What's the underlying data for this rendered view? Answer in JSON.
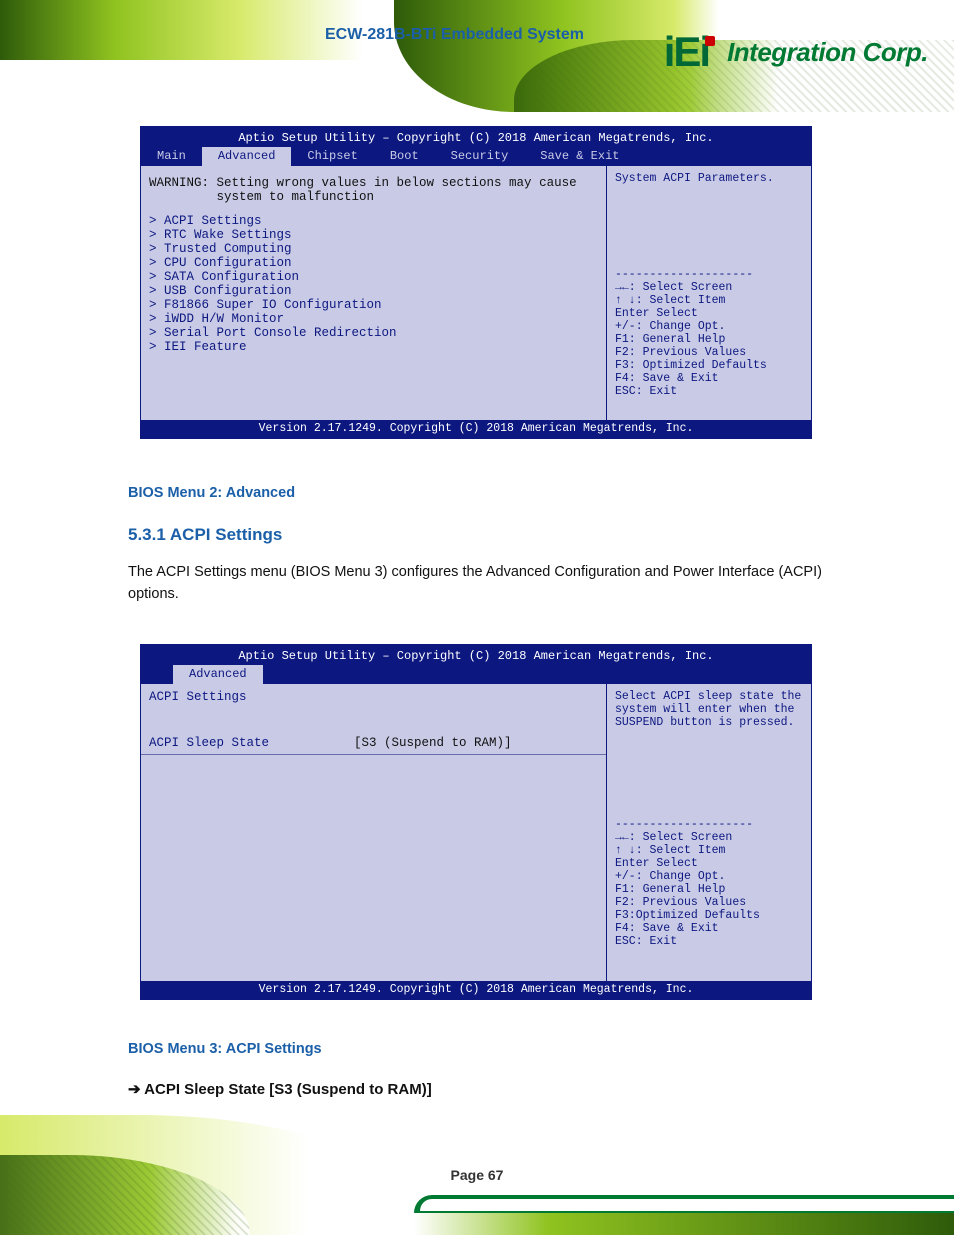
{
  "doc_title": "ECW-281B-BTi Embedded System",
  "logo": {
    "brand": "iEi",
    "suffix": "Integration Corp."
  },
  "bios1": {
    "top": "Aptio Setup Utility – Copyright (C) 2018 American Megatrends, Inc.",
    "tabs": [
      "Main",
      "Advanced",
      "Chipset",
      "Boot",
      "Security",
      "Save & Exit"
    ],
    "warn_line1": "WARNING: Setting wrong values in below sections may cause",
    "warn_line2": "         system to malfunction",
    "items": [
      "> ACPI Settings",
      "> RTC Wake Settings",
      "> Trusted Computing",
      "> CPU Configuration",
      "> SATA Configuration",
      "> USB Configuration",
      "> F81866 Super IO Configuration",
      "> iWDD H/W Monitor",
      "> Serial Port Console Redirection",
      "> IEI Feature"
    ],
    "help_desc": "System ACPI Parameters.",
    "help_lines": [
      "--------------------",
      "→←: Select Screen",
      "↑ ↓: Select Item",
      "Enter Select",
      "+/-: Change Opt.",
      "F1: General Help",
      "F2: Previous Values",
      "F3: Optimized Defaults",
      "F4: Save & Exit",
      "ESC: Exit"
    ],
    "foot": "Version 2.17.1249. Copyright (C) 2018 American Megatrends, Inc."
  },
  "text1": {
    "caption": "BIOS Menu 2: Advanced",
    "section": "5.3.1 ACPI Settings",
    "body": "The ACPI Settings menu (BIOS Menu 3) configures the Advanced Configuration and Power Interface (ACPI) options."
  },
  "bios2": {
    "top": "Aptio Setup Utility – Copyright (C) 2018 American Megatrends, Inc.",
    "tabs": [
      "",
      "Advanced"
    ],
    "subhdr": "ACPI Settings",
    "kv": {
      "label": "ACPI Sleep State",
      "value": "[S3 (Suspend to RAM)]"
    },
    "help_desc": "Select ACPI sleep state the system will enter when the SUSPEND button is pressed.",
    "help_lines": [
      "--------------------",
      "→←: Select Screen",
      "↑ ↓: Select Item",
      "Enter Select",
      "+/-: Change Opt.",
      "F1: General Help",
      "F2: Previous Values",
      "F3:Optimized Defaults",
      "F4: Save & Exit",
      "ESC: Exit"
    ],
    "foot": "Version 2.17.1249. Copyright (C) 2018 American Megatrends, Inc."
  },
  "text2": {
    "caption": "BIOS Menu 3: ACPI Settings",
    "subhd": "➔ ACPI Sleep State [S3 (Suspend to RAM)]"
  },
  "page_number": "Page 67"
}
